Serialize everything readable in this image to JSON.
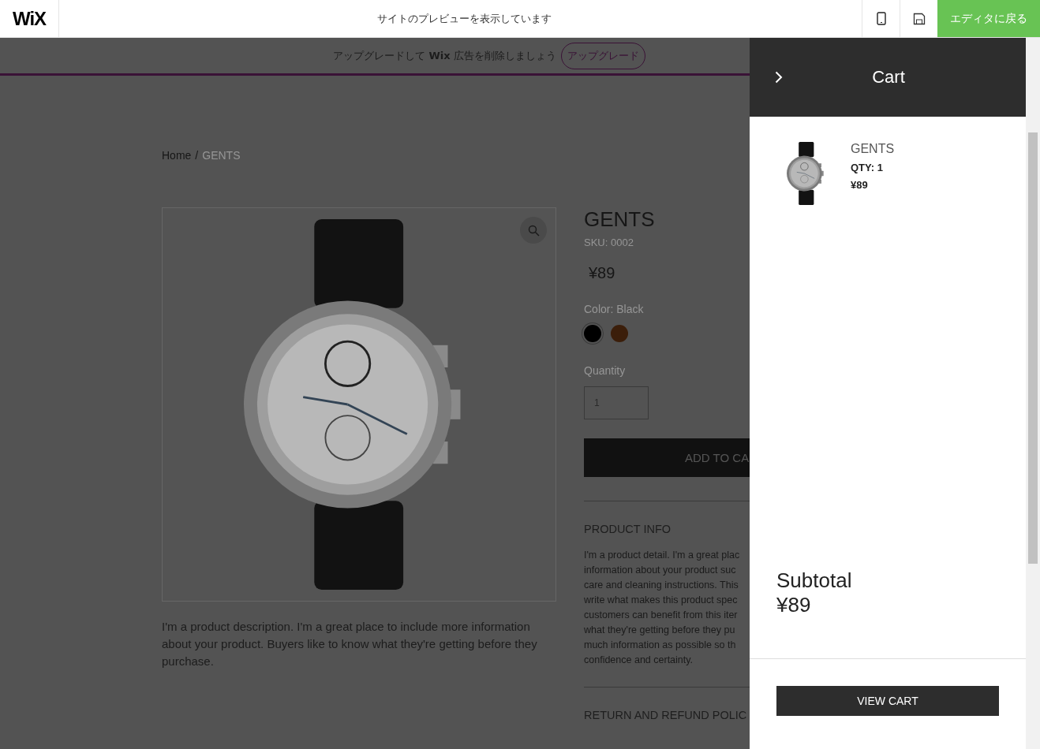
{
  "top_bar": {
    "logo": "WiX",
    "title": "サイトのプレビューを表示しています",
    "back_button": "エディタに戻る"
  },
  "banner": {
    "text": "アップグレードして **Wix** 広告を削除しましょう",
    "button": "アップグレード"
  },
  "breadcrumb": {
    "home": "Home",
    "separator": "/",
    "current": "GENTS"
  },
  "product": {
    "name": "GENTS",
    "sku": "SKU: 0002",
    "price": "¥89",
    "color_label": "Color: Black",
    "colors": [
      {
        "color": "#000000",
        "selected": true
      },
      {
        "color": "#3b1e0a",
        "selected": false
      }
    ],
    "quantity_label": "Quantity",
    "quantity": "1",
    "add_to_cart": "ADD TO CA",
    "description": "I'm a product description. I'm a great place to include more information about your product. Buyers like to know what they're getting before they purchase.",
    "info_title": "PRODUCT INFO",
    "info_lines": [
      "I'm a product detail. I'm a great plac",
      "information about your product suc",
      "care and cleaning instructions. This",
      "write what makes this product spec",
      "customers can benefit from this iter",
      "what they're getting before they pu",
      "much information as possible so th",
      "confidence and certainty."
    ],
    "refund_title": "RETURN AND REFUND POLIC"
  },
  "cart": {
    "title": "Cart",
    "items": [
      {
        "name": "GENTS",
        "qty": "QTY: 1",
        "price": "¥89"
      }
    ],
    "subtotal_label": "Subtotal",
    "subtotal": "¥89",
    "view_cart": "VIEW CART"
  }
}
